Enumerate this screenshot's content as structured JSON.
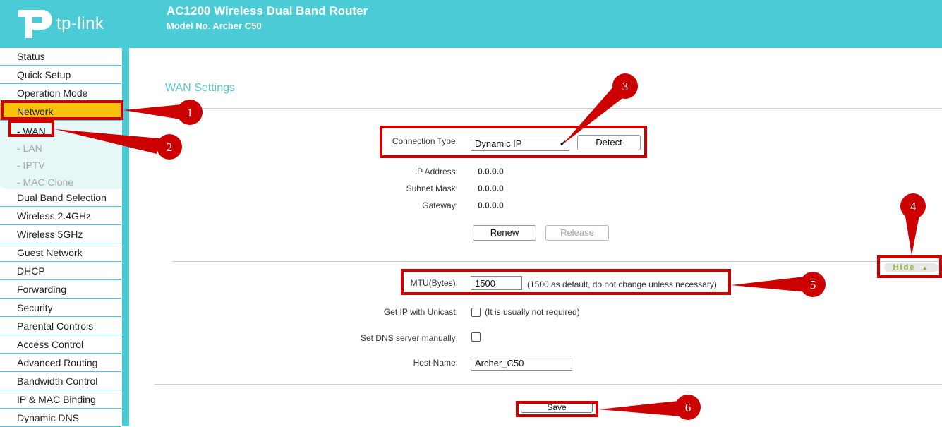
{
  "header": {
    "logo_text": "tp-link",
    "title": "AC1200 Wireless Dual Band Router",
    "model": "Model No. Archer C50"
  },
  "sidebar": {
    "items_top": [
      "Status",
      "Quick Setup",
      "Operation Mode",
      "Network"
    ],
    "sub_items": [
      "- WAN",
      "- LAN",
      "- IPTV",
      "- MAC Clone"
    ],
    "items_bottom": [
      "Dual Band Selection",
      "Wireless 2.4GHz",
      "Wireless 5GHz",
      "Guest Network",
      "DHCP",
      "Forwarding",
      "Security",
      "Parental Controls",
      "Access Control",
      "Advanced Routing",
      "Bandwidth Control",
      "IP & MAC Binding",
      "Dynamic DNS"
    ],
    "active_item": "Network",
    "active_sub_item": "- WAN"
  },
  "main": {
    "page_title": "WAN Settings",
    "connection_type": {
      "label": "Connection Type:",
      "value": "Dynamic IP",
      "detect_label": "Detect"
    },
    "ip_address": {
      "label": "IP Address:",
      "value": "0.0.0.0"
    },
    "subnet_mask": {
      "label": "Subnet Mask:",
      "value": "0.0.0.0"
    },
    "gateway": {
      "label": "Gateway:",
      "value": "0.0.0.0"
    },
    "renew_label": "Renew",
    "release_label": "Release",
    "hide_label": "Hide",
    "mtu": {
      "label": "MTU(Bytes):",
      "value": "1500",
      "note": "(1500 as default, do not change unless necessary)"
    },
    "unicast": {
      "label": "Get IP with Unicast:",
      "note": "(It is usually not required)"
    },
    "dns_manual": {
      "label": "Set DNS server manually:"
    },
    "host_name": {
      "label": "Host Name:",
      "value": "Archer_C50"
    },
    "save_label": "Save"
  },
  "callouts": [
    "1",
    "2",
    "3",
    "4",
    "5",
    "6"
  ],
  "colors": {
    "header": "#4acbd6",
    "active_menu": "#fbc20b",
    "annotation": "#cc0000"
  }
}
